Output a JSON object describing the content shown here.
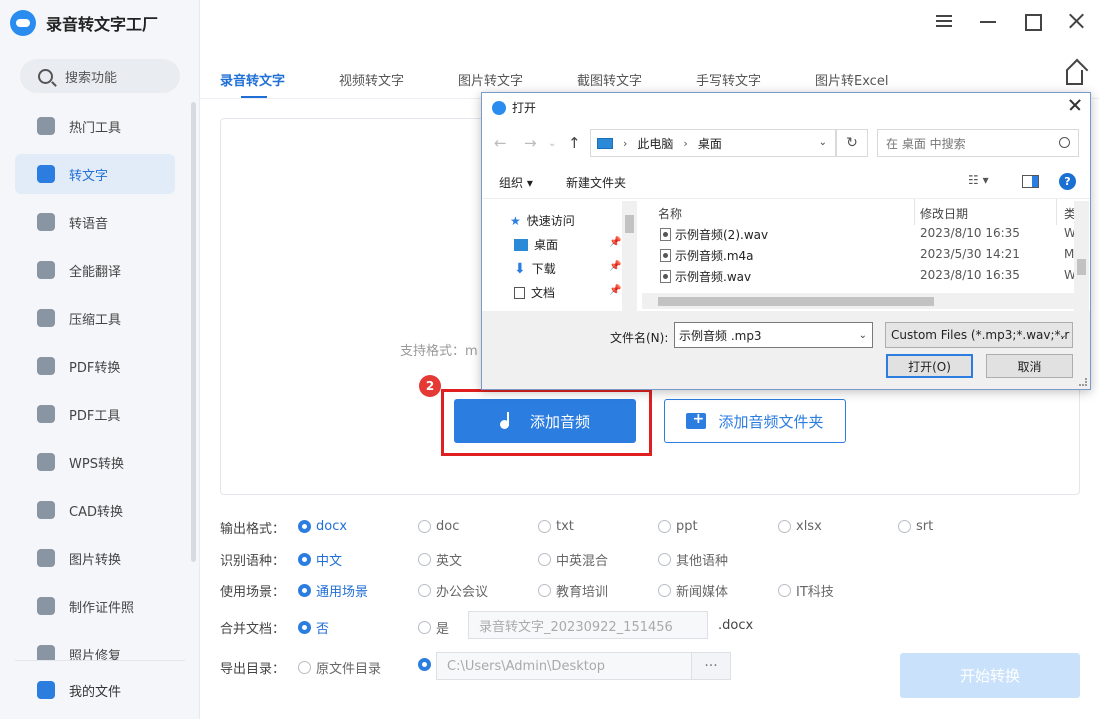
{
  "app": {
    "title": "录音转文字工厂"
  },
  "search": {
    "label": "搜索功能"
  },
  "sidebar": {
    "items": [
      {
        "label": "热门工具",
        "icon": "fire-icon"
      },
      {
        "label": "转文字",
        "icon": "text-convert-icon",
        "active": true
      },
      {
        "label": "转语音",
        "icon": "voice-icon"
      },
      {
        "label": "全能翻译",
        "icon": "translate-icon"
      },
      {
        "label": "压缩工具",
        "icon": "compress-icon"
      },
      {
        "label": "PDF转换",
        "icon": "pdf-convert-icon"
      },
      {
        "label": "PDF工具",
        "icon": "pdf-tools-icon"
      },
      {
        "label": "WPS转换",
        "icon": "wps-icon"
      },
      {
        "label": "CAD转换",
        "icon": "cad-icon"
      },
      {
        "label": "图片转换",
        "icon": "image-icon"
      },
      {
        "label": "制作证件照",
        "icon": "id-photo-icon"
      },
      {
        "label": "照片修复",
        "icon": "photo-repair-icon"
      }
    ],
    "my_files": "我的文件"
  },
  "tabs": [
    {
      "label": "录音转文字",
      "active": true
    },
    {
      "label": "视频转文字"
    },
    {
      "label": "图片转文字"
    },
    {
      "label": "截图转文字"
    },
    {
      "label": "手写转文字"
    },
    {
      "label": "图片转Excel"
    }
  ],
  "drop": {
    "formats": "支持格式：m",
    "step_badge": "2",
    "add_audio": "添加音频",
    "add_folder": "添加音频文件夹"
  },
  "options": {
    "output_format": {
      "label": "输出格式：",
      "choices": [
        "docx",
        "doc",
        "txt",
        "ppt",
        "xlsx",
        "srt"
      ],
      "selected": "docx"
    },
    "language": {
      "label": "识别语种：",
      "choices": [
        "中文",
        "英文",
        "中英混合",
        "其他语种"
      ],
      "selected": "中文"
    },
    "scene": {
      "label": "使用场景：",
      "choices": [
        "通用场景",
        "办公会议",
        "教育培训",
        "新闻媒体",
        "IT科技"
      ],
      "selected": "通用场景"
    },
    "merge": {
      "label": "合并文档：",
      "no": "否",
      "yes": "是",
      "filename": "录音转文字_20230922_151456",
      "suffix": ".docx"
    },
    "export": {
      "label": "导出目录：",
      "original": "原文件目录",
      "path": "C:\\Users\\Admin\\Desktop",
      "browse": "···"
    },
    "start": "开始转换"
  },
  "dialog": {
    "title": "打开",
    "path": [
      "此电脑",
      "桌面"
    ],
    "search_placeholder": "在 桌面 中搜索",
    "organize": "组织 ▾",
    "new_folder": "新建文件夹",
    "tree": [
      {
        "label": "快速访问"
      },
      {
        "label": "桌面"
      },
      {
        "label": "下载"
      },
      {
        "label": "文档"
      }
    ],
    "columns": {
      "name": "名称",
      "date": "修改日期",
      "type": "类"
    },
    "files": [
      {
        "name": "示例音频(2).wav",
        "date": "2023/8/10 16:35",
        "type": "W"
      },
      {
        "name": "示例音频.m4a",
        "date": "2023/5/30 14:21",
        "type": "M"
      },
      {
        "name": "示例音频.wav",
        "date": "2023/8/10 16:35",
        "type": "W"
      }
    ],
    "filename_label": "文件名(N):",
    "filename_value": "示例音频 .mp3",
    "filter": "Custom Files (*.mp3;*.wav;*.r",
    "open_btn": "打开(O)",
    "cancel_btn": "取消"
  },
  "colors": {
    "accent": "#2b7de0",
    "highlight": "#e02020"
  }
}
